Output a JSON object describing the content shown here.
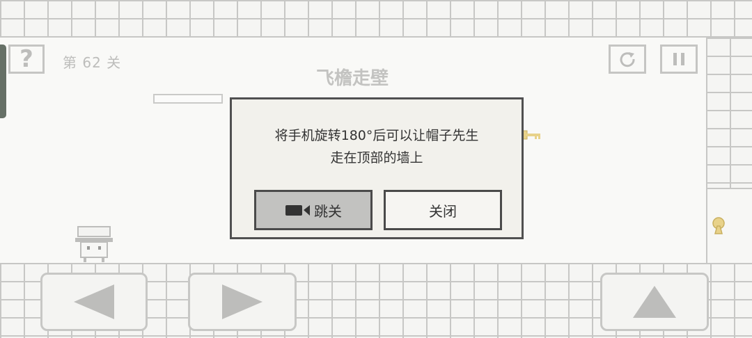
{
  "hud": {
    "help_label": "?",
    "level_label": "第 62 关",
    "level_title": "飞檐走壁"
  },
  "dialog": {
    "message_line1": "将手机旋转180°后可以让帽子先生",
    "message_line2": "走在顶部的墙上",
    "skip_label": "跳关",
    "close_label": "关闭"
  },
  "icons": {
    "help": "question-icon",
    "restart": "restart-icon",
    "pause": "pause-icon",
    "skip": "video-camera-icon",
    "left": "left-arrow-icon",
    "right": "right-arrow-icon",
    "jump": "up-arrow-icon",
    "key": "key-icon",
    "lock": "keyhole-icon"
  },
  "colors": {
    "wall_line": "#c7c7c5",
    "dialog_border": "#505050",
    "key": "#e8d28a"
  }
}
